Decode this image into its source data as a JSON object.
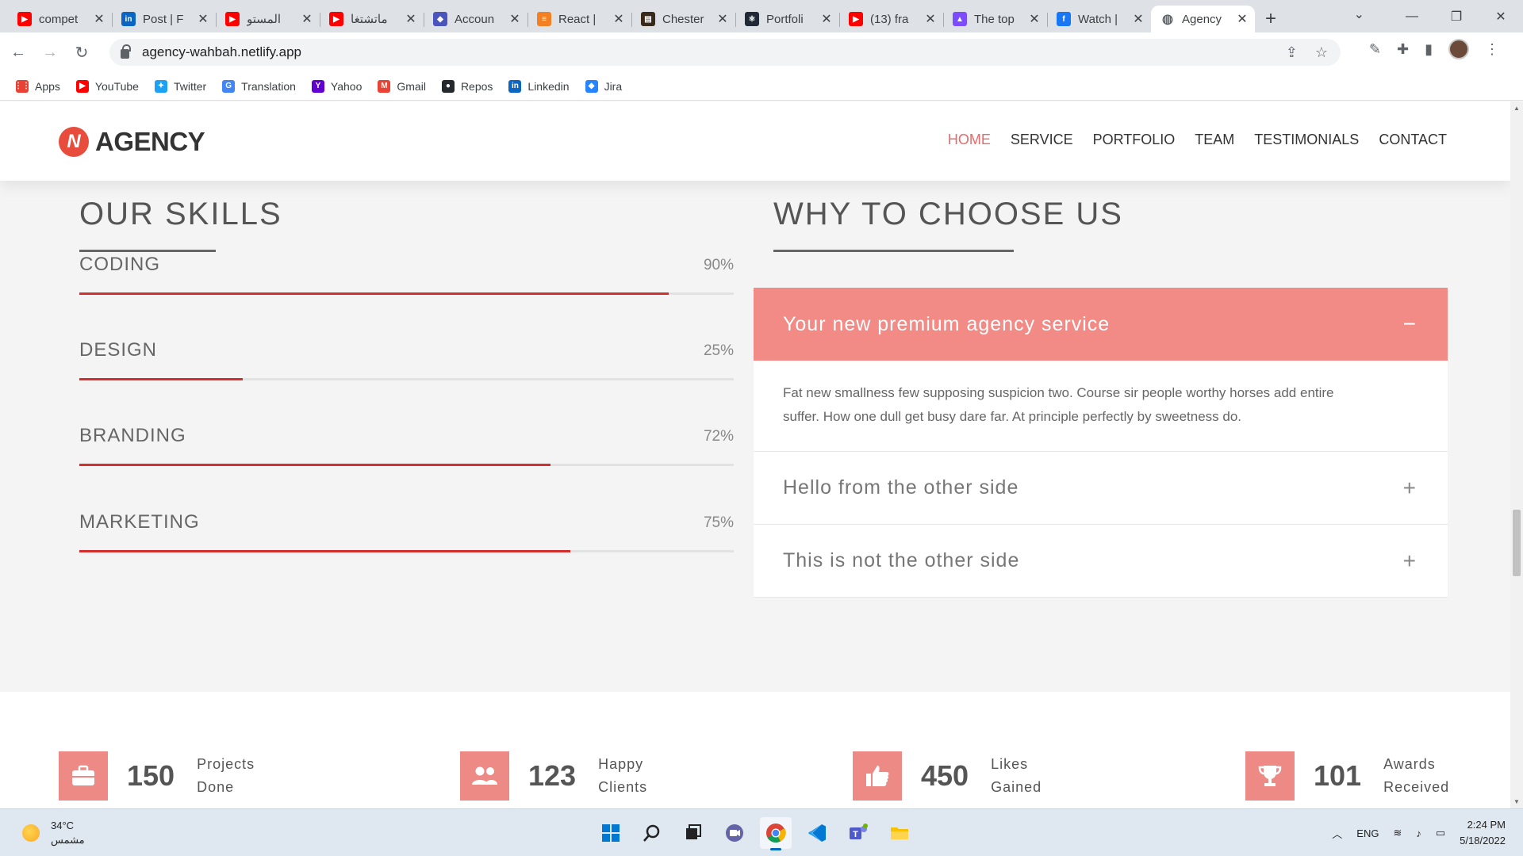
{
  "browser": {
    "tabs": [
      {
        "title": "compet",
        "icon": "youtube-icon",
        "color": "#ff0000"
      },
      {
        "title": "Post | F",
        "icon": "linkedin-icon",
        "color": "#0a66c2"
      },
      {
        "title": "المستو",
        "icon": "youtube-icon",
        "color": "#ff0000"
      },
      {
        "title": "ماتشتغا",
        "icon": "youtube-icon",
        "color": "#ff0000"
      },
      {
        "title": "Accoun",
        "icon": "azure-devops-icon",
        "color": "#4b53bc"
      },
      {
        "title": "React |",
        "icon": "stackoverflow-icon",
        "color": "#f48024"
      },
      {
        "title": "Chester",
        "icon": "book-icon",
        "color": "#3a2a1a"
      },
      {
        "title": "Portfoli",
        "icon": "react-icon",
        "color": "#1f2a36"
      },
      {
        "title": "(13) fra",
        "icon": "youtube-icon",
        "color": "#ff0000"
      },
      {
        "title": "The top",
        "icon": "rocket-icon",
        "color": "#7c4dff"
      },
      {
        "title": "Watch |",
        "icon": "facebook-icon",
        "color": "#1877f2"
      },
      {
        "title": "Agency",
        "icon": "globe-icon",
        "color": "#5f6368",
        "active": true
      }
    ],
    "url": "agency-wahbah.netlify.app",
    "bookmarks": [
      {
        "label": "Apps",
        "icon": "apps-grid-icon",
        "color": "#e94235"
      },
      {
        "label": "YouTube",
        "icon": "youtube-icon",
        "color": "#ff0000"
      },
      {
        "label": "Twitter",
        "icon": "twitter-icon",
        "color": "#1da1f2"
      },
      {
        "label": "Translation",
        "icon": "translate-icon",
        "color": "#4285f4"
      },
      {
        "label": "Yahoo",
        "icon": "yahoo-icon",
        "color": "#6001d2"
      },
      {
        "label": "Gmail",
        "icon": "gmail-icon",
        "color": "#ea4335"
      },
      {
        "label": "Repos",
        "icon": "github-icon",
        "color": "#24292e"
      },
      {
        "label": "Linkedin",
        "icon": "linkedin-icon",
        "color": "#0a66c2"
      },
      {
        "label": "Jira",
        "icon": "jira-icon",
        "color": "#2684ff"
      }
    ]
  },
  "site": {
    "logo_letter": "N",
    "logo_text": "AGENCY",
    "accent": "#f28a86",
    "nav": [
      "HOME",
      "SERVICE",
      "PORTFOLIO",
      "TEAM",
      "TESTIMONIALS",
      "CONTACT"
    ],
    "skills_title": "OUR SKILLS",
    "why_title": "WHY TO CHOOSE US",
    "skills": [
      {
        "name": "CODING",
        "percent": 90,
        "label": "90%"
      },
      {
        "name": "DESIGN",
        "percent": 25,
        "label": "25%"
      },
      {
        "name": "BRANDING",
        "percent": 72,
        "label": "72%"
      },
      {
        "name": "MARKETING",
        "percent": 75,
        "label": "75%"
      }
    ],
    "accordion": [
      {
        "title": "Your new premium agency service",
        "open": true,
        "toggle": "−",
        "body": "Fat new smallness few supposing suspicion two. Course sir people worthy horses add entire suffer. How one dull get busy dare far. At principle perfectly by sweetness do."
      },
      {
        "title": "Hello from the other side",
        "open": false,
        "toggle": "+"
      },
      {
        "title": "This is not the other side",
        "open": false,
        "toggle": "+"
      }
    ],
    "stats": [
      {
        "number": "150",
        "line1": "Projects",
        "line2": "Done",
        "icon": "briefcase-icon"
      },
      {
        "number": "123",
        "line1": "Happy",
        "line2": "Clients",
        "icon": "users-icon"
      },
      {
        "number": "450",
        "line1": "Likes",
        "line2": "Gained",
        "icon": "thumbs-up-icon"
      },
      {
        "number": "101",
        "line1": "Awards",
        "line2": "Received",
        "icon": "trophy-icon"
      }
    ]
  },
  "taskbar": {
    "temperature": "34°C",
    "weather": "مشمس",
    "language": "ENG",
    "time": "2:24 PM",
    "date": "5/18/2022"
  }
}
